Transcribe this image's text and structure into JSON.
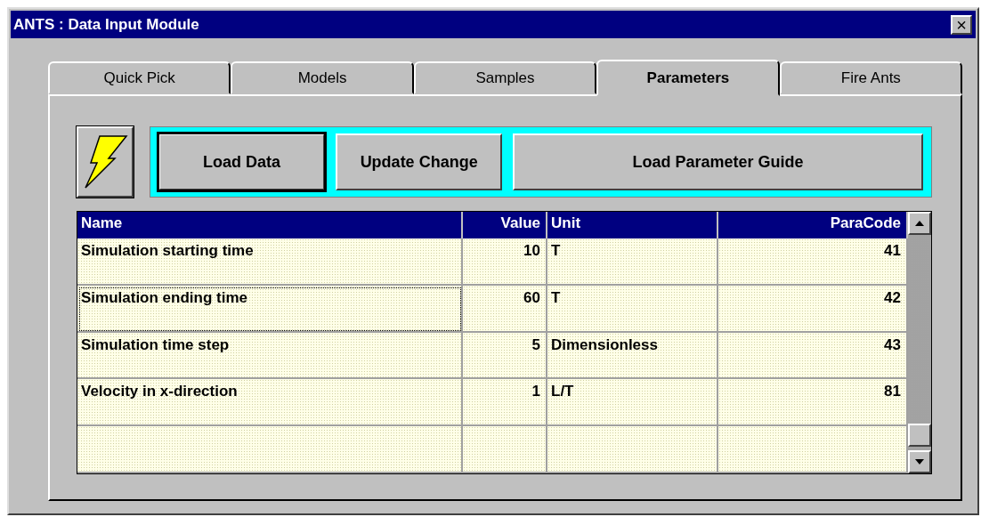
{
  "window": {
    "title": "ANTS : Data Input Module",
    "close": "×"
  },
  "tabs": [
    {
      "label": "Quick Pick",
      "selected": false
    },
    {
      "label": "Models",
      "selected": false
    },
    {
      "label": "Samples",
      "selected": false
    },
    {
      "label": "Parameters",
      "selected": true
    },
    {
      "label": "Fire Ants",
      "selected": false
    }
  ],
  "toolbar": {
    "buttons": [
      {
        "label": "Load Data",
        "default": true
      },
      {
        "label": "Update Change",
        "default": false
      },
      {
        "label": "Load Parameter Guide",
        "default": false
      }
    ]
  },
  "table": {
    "columns": [
      "Name",
      "Value",
      "Unit",
      "ParaCode"
    ],
    "rows": [
      {
        "cells": [
          "Simulation starting time",
          "10",
          "T",
          "41"
        ],
        "focused": false
      },
      {
        "cells": [
          "Simulation ending time",
          "60",
          "T",
          "42"
        ],
        "focused": true
      },
      {
        "cells": [
          "Simulation time step",
          "5",
          "Dimensionless",
          "43"
        ],
        "focused": false
      },
      {
        "cells": [
          "Velocity in x-direction",
          "1",
          "L/T",
          "81"
        ],
        "focused": false
      },
      {
        "cells": [],
        "focused": false
      }
    ]
  }
}
